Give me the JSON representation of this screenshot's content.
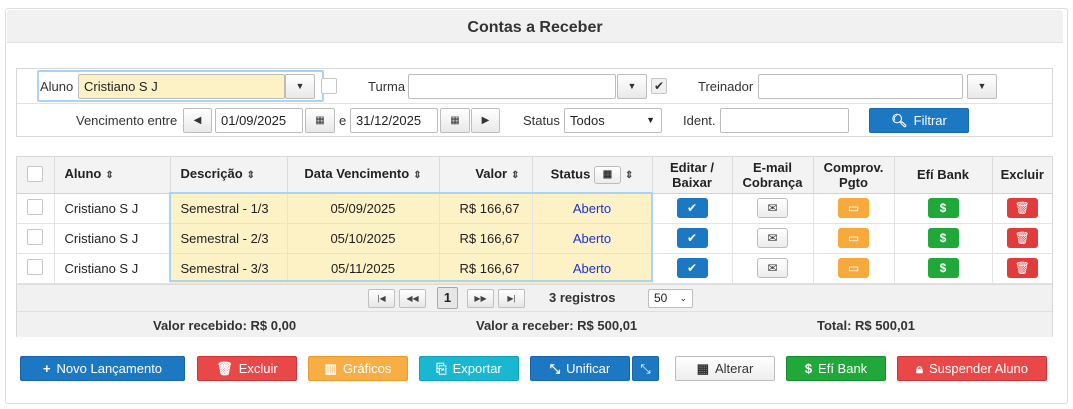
{
  "title": "Contas a Receber",
  "filters": {
    "aluno_label": "Aluno",
    "aluno_value": "Cristiano S J",
    "turma_label": "Turma",
    "turma_value": "",
    "treinador_label": "Treinador",
    "treinador_value": "",
    "vencimento_label": "Vencimento entre",
    "date_from": "01/09/2025",
    "date_sep": "e",
    "date_to": "31/12/2025",
    "status_label": "Status",
    "status_value": "Todos",
    "ident_label": "Ident.",
    "ident_value": "",
    "filter_button": "Filtrar"
  },
  "table": {
    "headers": {
      "aluno": "Aluno",
      "descricao": "Descrição",
      "data_vencimento": "Data Vencimento",
      "valor": "Valor",
      "status": "Status",
      "editar_l1": "Editar /",
      "editar_l2": "Baixar",
      "email_l1": "E-mail",
      "email_l2": "Cobrança",
      "comprov_l1": "Comprov.",
      "comprov_l2": "Pgto",
      "efi": "Efí Bank",
      "excluir": "Excluir"
    },
    "rows": [
      {
        "aluno": "Cristiano S J",
        "descricao": "Semestral - 1/3",
        "vencimento": "05/09/2025",
        "valor": "R$ 166,67",
        "status": "Aberto"
      },
      {
        "aluno": "Cristiano S J",
        "descricao": "Semestral - 2/3",
        "vencimento": "05/10/2025",
        "valor": "R$ 166,67",
        "status": "Aberto"
      },
      {
        "aluno": "Cristiano S J",
        "descricao": "Semestral - 3/3",
        "vencimento": "05/11/2025",
        "valor": "R$ 166,67",
        "status": "Aberto"
      }
    ]
  },
  "pager": {
    "current_page": "1",
    "records": "3 registros",
    "page_size": "50"
  },
  "totals": {
    "recebido": "Valor recebido: R$ 0,00",
    "a_receber": "Valor a receber: R$ 500,01",
    "total": "Total: R$ 500,01"
  },
  "actions": {
    "novo": "Novo Lançamento",
    "excluir": "Excluir",
    "graficos": "Gráficos",
    "exportar": "Exportar",
    "unificar": "Unificar",
    "alterar": "Alterar",
    "efi": "Efí Bank",
    "suspender": "Suspender Aluno"
  },
  "colors": {
    "primary": "#1d78c4",
    "danger": "#e94848",
    "warning": "#f8ae45",
    "info": "#19b7d1",
    "success": "#20a83a",
    "highlight": "#fdf1c6",
    "status_link": "#1b33cf"
  },
  "icons": {
    "edit": "check-icon",
    "email": "envelope-icon",
    "comprov": "note-icon",
    "efi": "dollar-icon",
    "delete": "trash-icon"
  }
}
